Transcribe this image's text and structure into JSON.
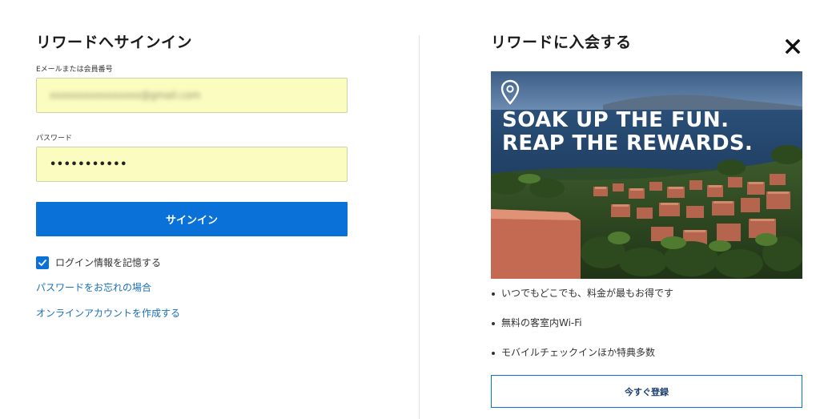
{
  "signin": {
    "title": "リワードへサインイン",
    "email_label": "Eメールまたは会員番号",
    "email_value": "xxxxxxxxxxxxxxxx@gmail.com",
    "password_label": "パスワード",
    "password_value": "•••••••••••",
    "submit_label": "サインイン",
    "remember_label": "ログイン情報を記憶する",
    "remember_checked": true,
    "forgot_password_link": "パスワードをお忘れの場合",
    "create_account_link": "オンラインアカウントを作成する"
  },
  "join": {
    "title": "リワードに入会する",
    "close_icon": "close-icon",
    "promo": {
      "headline_line1": "SOAK UP THE FUN.",
      "headline_line2": "REAP THE REWARDS.",
      "pin_icon": "location-pin-icon"
    },
    "benefits": [
      "いつでもどこでも、料金が最もお得です",
      "無料の客室内Wi-Fi",
      "モバイルチェックインほか特典多数"
    ],
    "join_button_label": "今すぐ登録"
  },
  "colors": {
    "primary": "#0a71d8",
    "input_autofill": "#fafcc0",
    "link": "#1a6fb8",
    "heading": "#1a1a1a"
  }
}
